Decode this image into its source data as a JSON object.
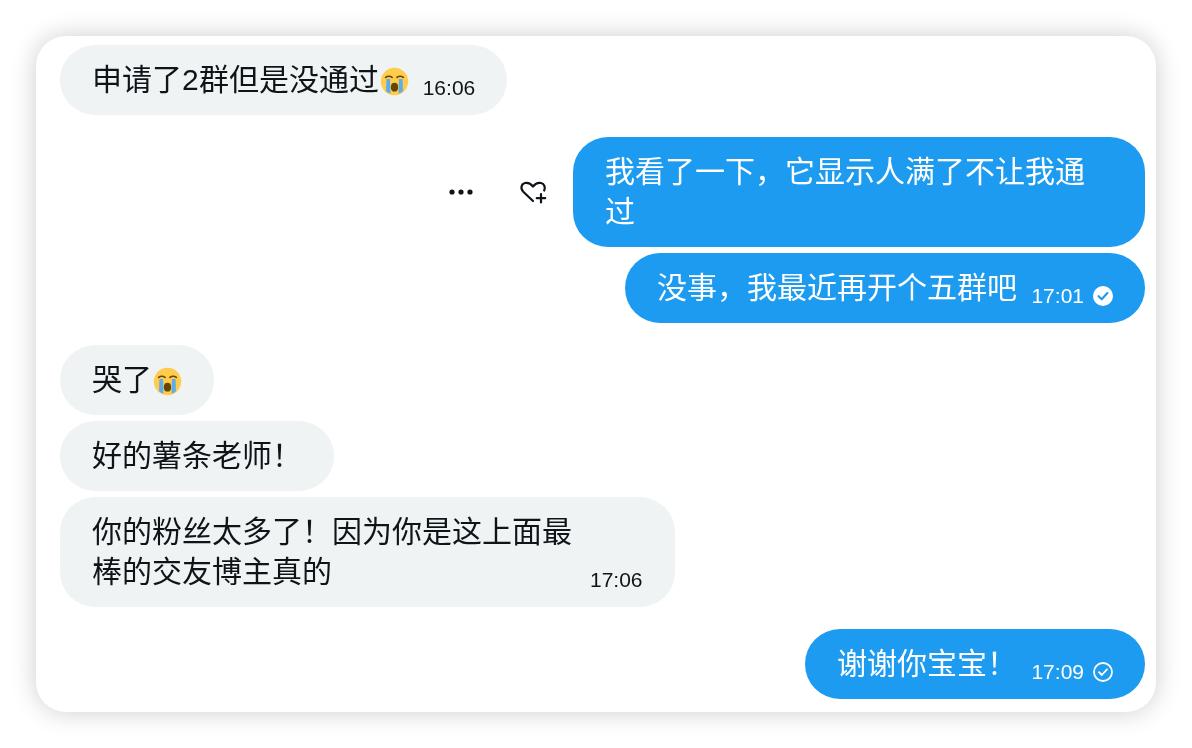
{
  "messages": [
    {
      "kind": "incoming",
      "text": "申请了2群但是没通过",
      "emoji": true,
      "time": "16:06",
      "hovered": false
    },
    {
      "kind": "outgoing",
      "text": "我看了一下，它显示人满了不让我通过",
      "emoji": false,
      "hovered": true
    },
    {
      "kind": "outgoing",
      "text": "没事，我最近再开个五群吧",
      "emoji": false,
      "time": "17:01",
      "read": true,
      "hovered": false
    },
    {
      "kind": "incoming",
      "text": "哭了",
      "emoji": true,
      "hovered": false
    },
    {
      "kind": "incoming",
      "text": "好的薯条老师！",
      "emoji": false,
      "hovered": false
    },
    {
      "kind": "incoming",
      "text": "你的粉丝太多了！因为你是这上面最棒的交友博主真的",
      "emoji": false,
      "time": "17:06",
      "hovered": false
    },
    {
      "kind": "outgoing",
      "text": "谢谢你宝宝！",
      "emoji": false,
      "time": "17:09",
      "read": false,
      "hovered": false
    }
  ]
}
